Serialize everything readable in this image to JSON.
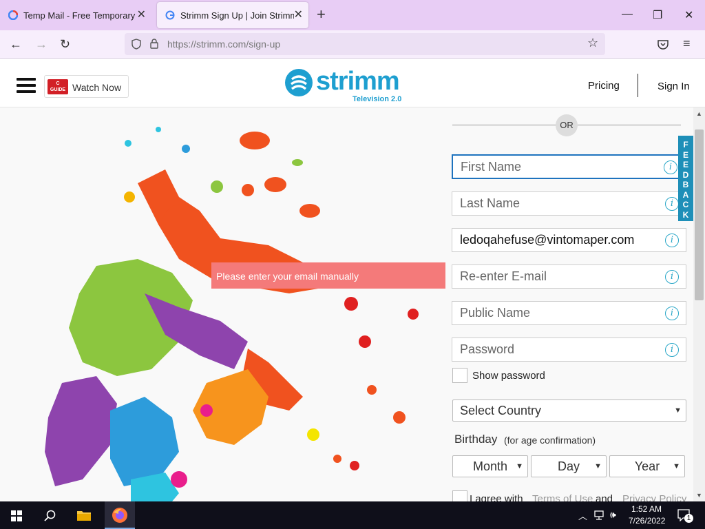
{
  "browser": {
    "tabs": [
      {
        "title": "Temp Mail - Free Temporary Email",
        "active": false
      },
      {
        "title": "Strimm Sign Up | Join Strimm",
        "active": true
      }
    ],
    "url": "https://strimm.com/sign-up"
  },
  "header": {
    "watch_now": "Watch Now",
    "guide_logo": "GUIDE",
    "logo_text": "strimm",
    "logo_sub": "Television 2.0",
    "pricing": "Pricing",
    "sign_in": "Sign In"
  },
  "form": {
    "or_label": "OR",
    "first_name_placeholder": "First Name",
    "last_name_placeholder": "Last Name",
    "email_value": "ledoqahefuse@vintomaper.com",
    "reenter_email_placeholder": "Re-enter E-mail",
    "public_name_placeholder": "Public Name",
    "password_placeholder": "Password",
    "show_password": "Show password",
    "country_select": "Select Country",
    "birthday_label": "Birthday",
    "birthday_note": "(for age confirmation)",
    "month": "Month",
    "day": "Day",
    "year": "Year",
    "agree_prefix": "I agree with",
    "terms": "Terms of Use",
    "and": "and",
    "privacy": "Privacy Policy",
    "error_tooltip": "Please enter your email manually"
  },
  "feedback": "FEEDBACK",
  "taskbar": {
    "time": "1:52 AM",
    "date": "7/26/2022",
    "notification_count": "1"
  },
  "colors": {
    "accent": "#1e8fb8",
    "tab_bar": "#e8cdf5",
    "error": "#f47a7a"
  }
}
